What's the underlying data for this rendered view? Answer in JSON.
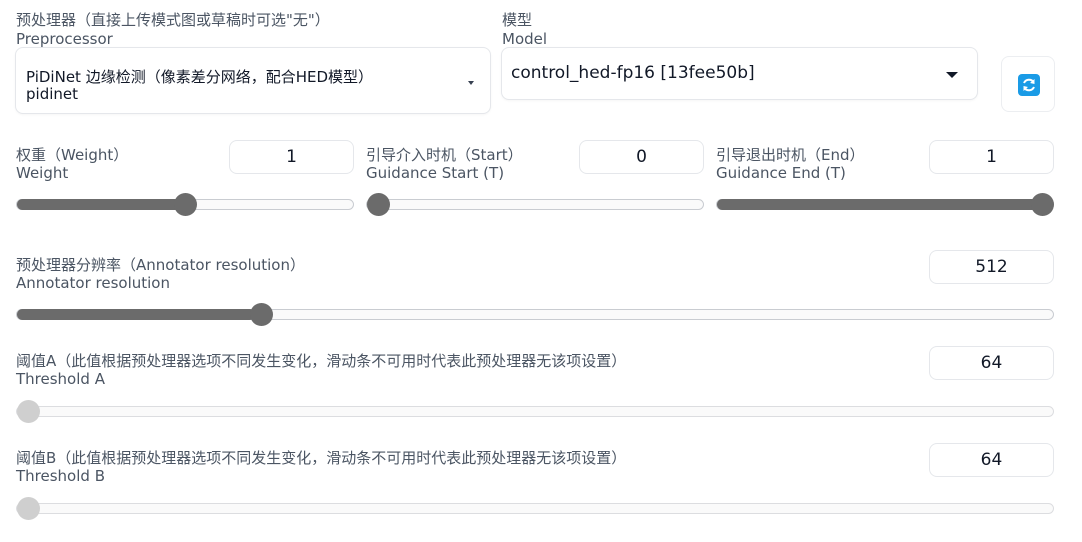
{
  "preprocessor": {
    "label_main": "预处理器（直接上传模式图或草稿时可选\"无\"）",
    "label_sub": "Preprocessor",
    "selected_line1": "PiDiNet 边缘检测（像素差分网络，配合HED模型）",
    "selected_line2": "pidinet"
  },
  "model": {
    "label_main": "模型",
    "label_sub": "Model",
    "selected": "control_hed-fp16 [13fee50b]"
  },
  "weight": {
    "label_main": "权重（Weight）",
    "label_sub": "Weight",
    "value": "1",
    "slider_fraction": 0.5
  },
  "guidance_start": {
    "label_main": "引导介入时机（Start）",
    "label_sub": "Guidance Start (T)",
    "value": "0",
    "slider_fraction": 0
  },
  "guidance_end": {
    "label_main": "引导退出时机（End）",
    "label_sub": "Guidance End (T)",
    "value": "1",
    "slider_fraction": 1
  },
  "annotator_resolution": {
    "label_main": "预处理器分辨率（Annotator resolution）",
    "label_sub": "Annotator resolution",
    "value": "512",
    "slider_fraction": 0.23
  },
  "threshold_a": {
    "label_main": "阈值A（此值根据预处理器选项不同发生变化，滑动条不可用时代表此预处理器无该项设置）",
    "label_sub": "Threshold A",
    "value": "64",
    "slider_fraction": 0
  },
  "threshold_b": {
    "label_main": "阈值B（此值根据预处理器选项不同发生变化，滑动条不可用时代表此预处理器无该项设置）",
    "label_sub": "Threshold B",
    "value": "64",
    "slider_fraction": 0
  },
  "icons": {
    "refresh": "refresh-icon",
    "dropdown_caret": "caret-down-icon"
  },
  "colors": {
    "slider_active": "#6b6b6b",
    "slider_disabled": "#cfcfcf",
    "refresh_icon": "#1a9be6"
  }
}
